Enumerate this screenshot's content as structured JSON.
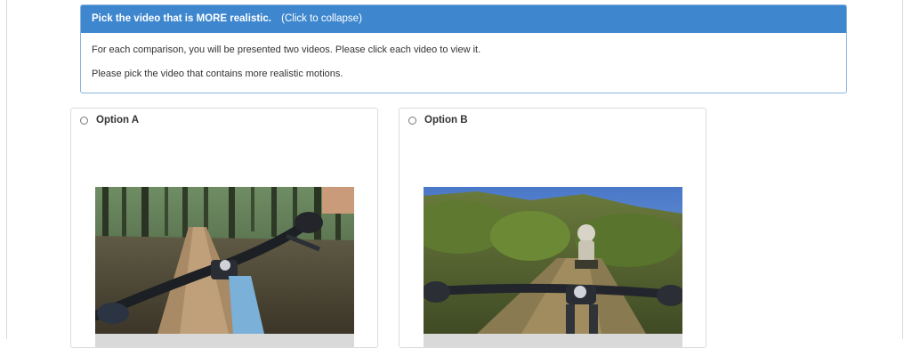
{
  "panel": {
    "title": "Pick the video that is MORE realistic.",
    "collapse_hint": "(Click to collapse)",
    "instructions": [
      "For each comparison, you will be presented two videos. Please click each video to view it.",
      "Please pick the video that contains more realistic motions."
    ]
  },
  "options": [
    {
      "label": "Option A",
      "selected": false,
      "video_description": "first-person mountain bike view on forest dirt trail"
    },
    {
      "label": "Option B",
      "selected": false,
      "video_description": "first-person mountain bike view following another rider on grassy trail"
    }
  ],
  "colors": {
    "panel_header": "#3e87cf",
    "panel_border": "#8ab3de",
    "card_border": "#dcdcdc"
  }
}
